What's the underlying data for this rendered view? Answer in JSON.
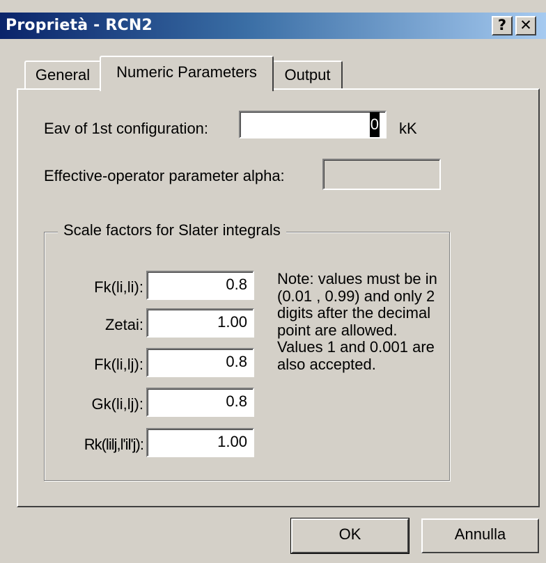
{
  "window": {
    "title": "Proprietà - RCN2",
    "help_glyph": "?",
    "close_glyph": "✕"
  },
  "tabs": [
    {
      "label": "General",
      "selected": false
    },
    {
      "label": "Numeric Parameters",
      "selected": true
    },
    {
      "label": "Output",
      "selected": false
    }
  ],
  "form": {
    "eav_label": "Eav of 1st configuration:",
    "eav_value": "0",
    "eav_unit": "kK",
    "alpha_label": "Effective-operator parameter alpha:",
    "alpha_value": ""
  },
  "scale_group": {
    "title": "Scale factors for Slater integrals",
    "rows": [
      {
        "label": "Fk(li,li):",
        "value": "0.8"
      },
      {
        "label": "Zetai:",
        "value": "1.00"
      },
      {
        "label": "Fk(li,lj):",
        "value": "0.8"
      },
      {
        "label": "Gk(li,lj):",
        "value": "0.8"
      },
      {
        "label": "Rk(lilj,l'il'j):",
        "value": "1.00"
      }
    ],
    "note": "Note: values must be in (0.01 , 0.99) and only 2 digits after the decimal point are allowed. Values 1 and 0.001 are also accepted."
  },
  "buttons": {
    "ok": "OK",
    "cancel": "Annulla"
  },
  "colors": {
    "title_start": "#0a246a",
    "title_end": "#a6caf0",
    "face": "#d4d0c8"
  }
}
